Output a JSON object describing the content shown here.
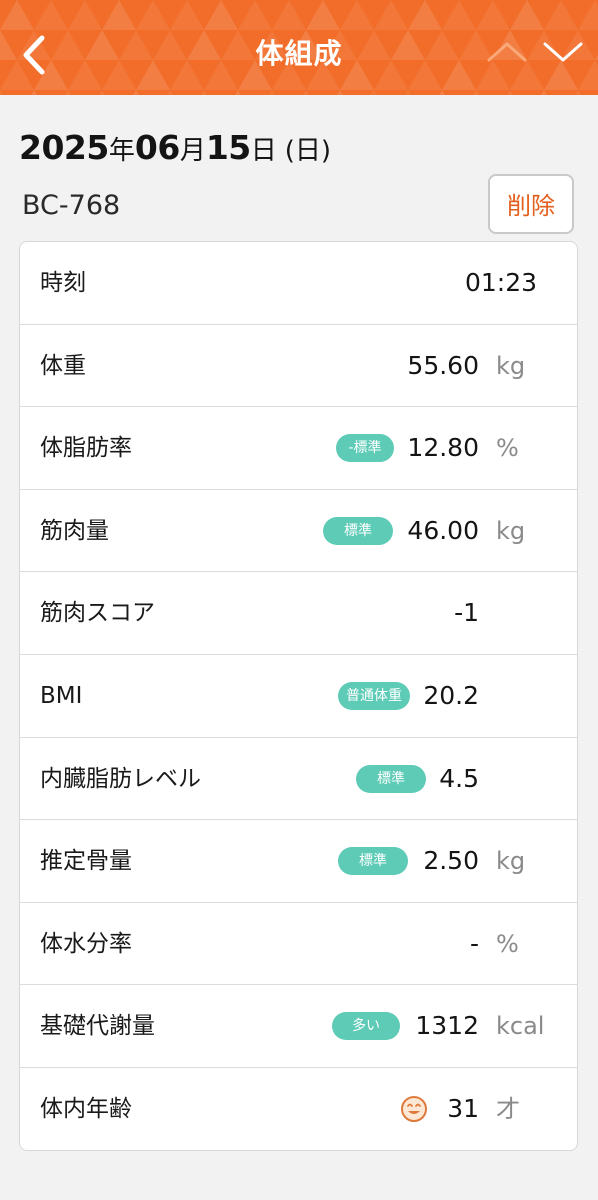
{
  "header": {
    "title": "体組成",
    "back_icon": "chevron-left-icon",
    "prev_icon": "chevron-up-icon",
    "next_icon": "chevron-down-icon",
    "background_color": "#f26d2a"
  },
  "date": {
    "year": "2025",
    "year_unit": "年",
    "month": "06",
    "month_unit": "月",
    "day": "15",
    "day_unit": "日",
    "weekday": "(日)"
  },
  "device": "BC-768",
  "delete_label": "削除",
  "badge_color": "#5ecbb6",
  "rows": [
    {
      "label": "時刻",
      "value": "01:23",
      "unit": "",
      "badge": ""
    },
    {
      "label": "体重",
      "value": "55.60",
      "unit": "kg",
      "badge": ""
    },
    {
      "label": "体脂肪率",
      "value": "12.80",
      "unit": "%",
      "badge": "-標準"
    },
    {
      "label": "筋肉量",
      "value": "46.00",
      "unit": "kg",
      "badge": "標準"
    },
    {
      "label": "筋肉スコア",
      "value": "-1",
      "unit": "",
      "badge": ""
    },
    {
      "label": "BMI",
      "value": "20.2",
      "unit": "",
      "badge": "普通体重"
    },
    {
      "label": "内臓脂肪レベル",
      "value": "4.5",
      "unit": "",
      "badge": "標準"
    },
    {
      "label": "推定骨量",
      "value": "2.50",
      "unit": "kg",
      "badge": "標準"
    },
    {
      "label": "体水分率",
      "value": "-",
      "unit": "%",
      "badge": ""
    },
    {
      "label": "基礎代謝量",
      "value": "1312",
      "unit": "kcal",
      "badge": "多い"
    },
    {
      "label": "体内年齢",
      "value": "31",
      "unit": "才",
      "badge": "",
      "icon": "smiley-face-icon"
    }
  ]
}
